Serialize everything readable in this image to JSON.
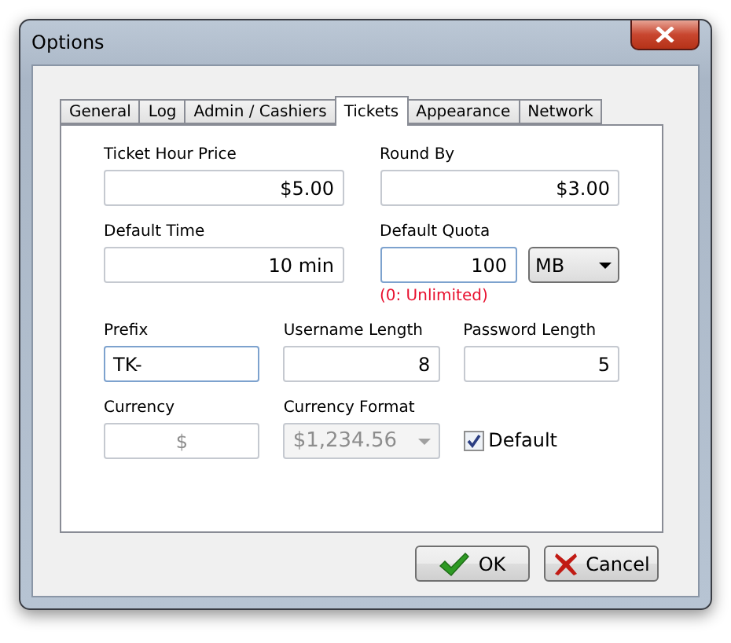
{
  "window": {
    "title": "Options"
  },
  "tabs": [
    {
      "label": "General",
      "selected": false
    },
    {
      "label": "Log",
      "selected": false
    },
    {
      "label": "Admin / Cashiers",
      "selected": false
    },
    {
      "label": "Tickets",
      "selected": true
    },
    {
      "label": "Appearance",
      "selected": false
    },
    {
      "label": "Network",
      "selected": false
    }
  ],
  "rows": [
    [
      {
        "kind": "number",
        "label": "Ticket Hour Price",
        "value": "$5.00",
        "disabled": false,
        "focused": false
      },
      {
        "kind": "number",
        "label": "Round By",
        "value": "$3.00",
        "disabled": false,
        "focused": false
      }
    ],
    [
      {
        "kind": "number",
        "label": "Default Time",
        "value": "10 min",
        "disabled": false,
        "focused": false
      },
      {
        "kind": "quota",
        "label": "Default Quota",
        "value": "100",
        "disabled": false,
        "focused": true,
        "unit": "MB",
        "note": "(0: Unlimited)"
      }
    ],
    [
      {
        "kind": "text",
        "label": "Prefix",
        "value": "TK-",
        "disabled": false,
        "focused": true
      },
      {
        "kind": "number",
        "label": "Username Length",
        "value": "8",
        "disabled": false,
        "focused": false
      },
      {
        "kind": "number",
        "label": "Password Length",
        "value": "5",
        "disabled": false,
        "focused": false
      }
    ],
    [
      {
        "kind": "symbol",
        "label": "Currency",
        "value": "$",
        "disabled": true,
        "focused": false
      },
      {
        "kind": "select",
        "label": "Currency Format",
        "value": "$1,234.56",
        "disabled": true
      },
      {
        "kind": "checkbox",
        "label": "Default",
        "checked": true
      }
    ]
  ],
  "buttons": [
    {
      "kind": "ok",
      "label": "OK"
    },
    {
      "kind": "cancel",
      "label": "Cancel"
    }
  ]
}
